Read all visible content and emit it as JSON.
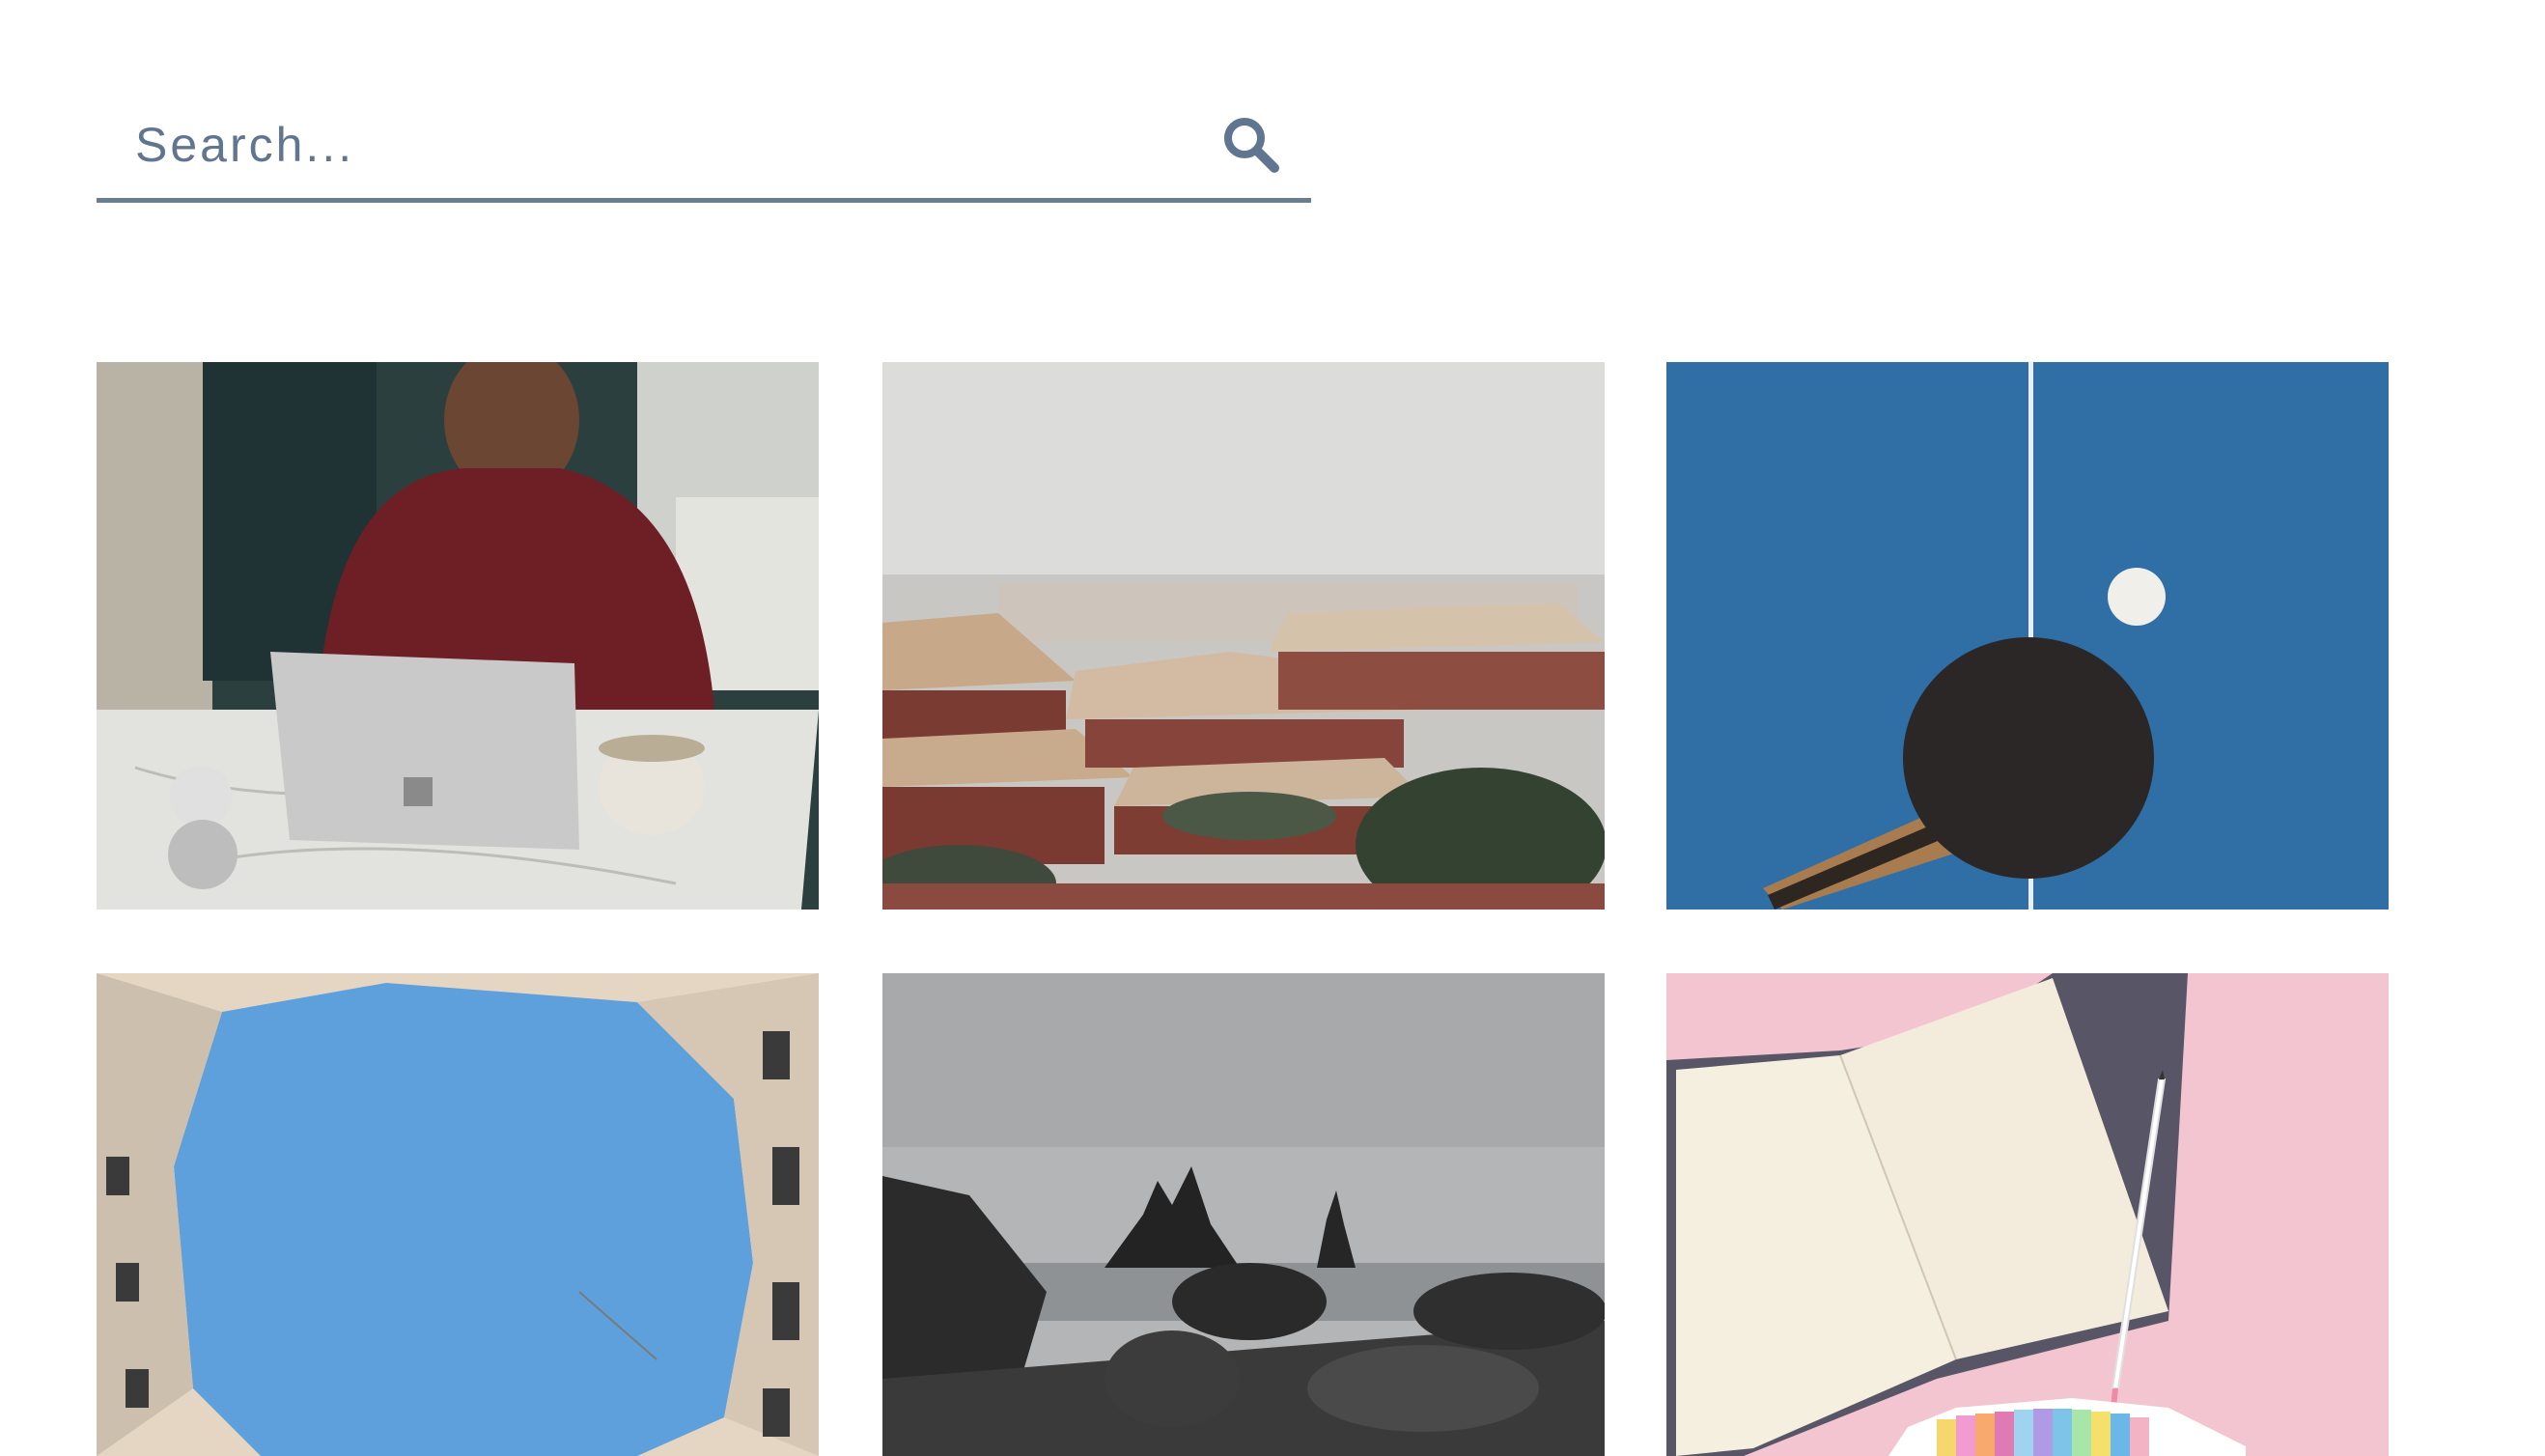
{
  "search": {
    "placeholder": "Search...",
    "value": "",
    "icon": "search-icon",
    "accent_color": "#6b7d91"
  },
  "gallery": {
    "images": [
      {
        "name": "person-with-laptop-at-kitchen-table"
      },
      {
        "name": "palace-rooftops-in-snow"
      },
      {
        "name": "ping-pong-paddle-on-blue-table"
      },
      {
        "name": "courtyard-looking-up-at-sky"
      },
      {
        "name": "rocky-beach-with-sea-stacks"
      },
      {
        "name": "open-notebook-on-pink-background"
      }
    ]
  }
}
